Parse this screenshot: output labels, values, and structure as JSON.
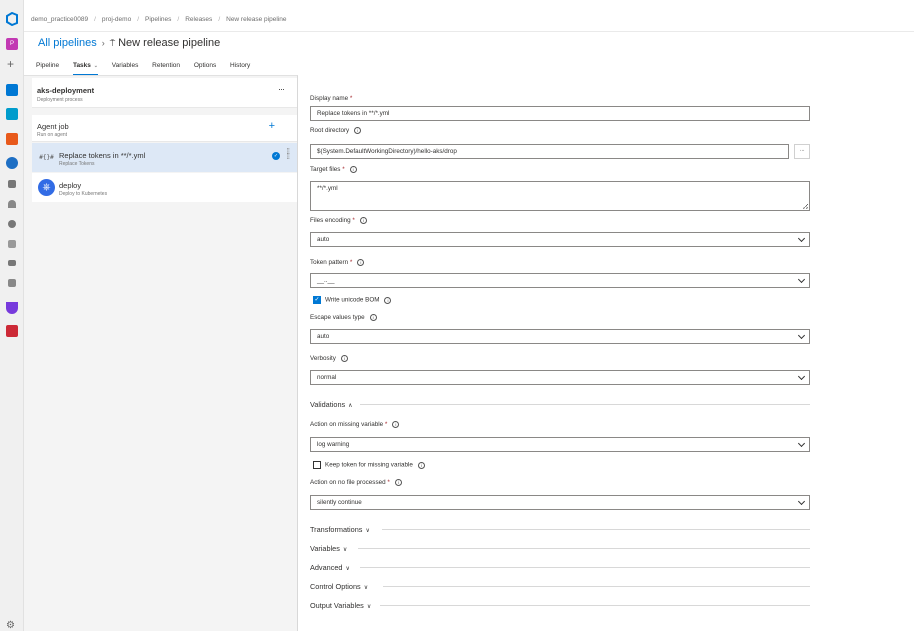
{
  "breadcrumbs": [
    "demo_practice0089",
    "proj-demo",
    "Pipelines",
    "Releases",
    "New release pipeline"
  ],
  "header": {
    "parent_link": "All pipelines",
    "title": "New release pipeline"
  },
  "tabs": [
    {
      "label": "Pipeline"
    },
    {
      "label": "Tasks",
      "caret": "⌄"
    },
    {
      "label": "Variables"
    },
    {
      "label": "Retention"
    },
    {
      "label": "Options"
    },
    {
      "label": "History"
    }
  ],
  "stage": {
    "name": "aks-deployment",
    "subtitle": "Deployment process",
    "more": "···"
  },
  "job": {
    "name": "Agent job",
    "subtitle": "Run on agent",
    "add": "+"
  },
  "tasks": [
    {
      "name": "Replace tokens in **/*.yml",
      "subtitle": "Replace Tokens",
      "icon": "#{}#"
    },
    {
      "name": "deploy",
      "subtitle": "Deploy to Kubernetes",
      "icon": "⎈"
    }
  ],
  "form": {
    "display_name": {
      "label": "Display name",
      "value": "Replace tokens in **/*.yml"
    },
    "root_directory": {
      "label": "Root directory",
      "value": "$(System.DefaultWorkingDirectory)/hello-aks/drop",
      "browse": "···"
    },
    "target_files": {
      "label": "Target files",
      "value": "**/*.yml"
    },
    "files_encoding": {
      "label": "Files encoding",
      "value": "auto"
    },
    "token_pattern": {
      "label": "Token pattern",
      "value": "__..__"
    },
    "write_unicode_bom": {
      "label": "Write unicode BOM",
      "checked": true
    },
    "escape_values_type": {
      "label": "Escape values type",
      "value": "auto"
    },
    "verbosity": {
      "label": "Verbosity",
      "value": "normal"
    },
    "validations": {
      "label": "Validations"
    },
    "action_missing_variable": {
      "label": "Action on missing variable",
      "value": "log warning"
    },
    "keep_token": {
      "label": "Keep token for missing variable",
      "checked": false
    },
    "action_no_file": {
      "label": "Action on no file processed",
      "value": "silently continue"
    },
    "sections": [
      "Transformations",
      "Variables",
      "Advanced",
      "Control Options",
      "Output Variables"
    ]
  },
  "colors": {
    "accent": "#0078d4",
    "selected_task": "#dde8f6",
    "required": "#a4262c"
  }
}
